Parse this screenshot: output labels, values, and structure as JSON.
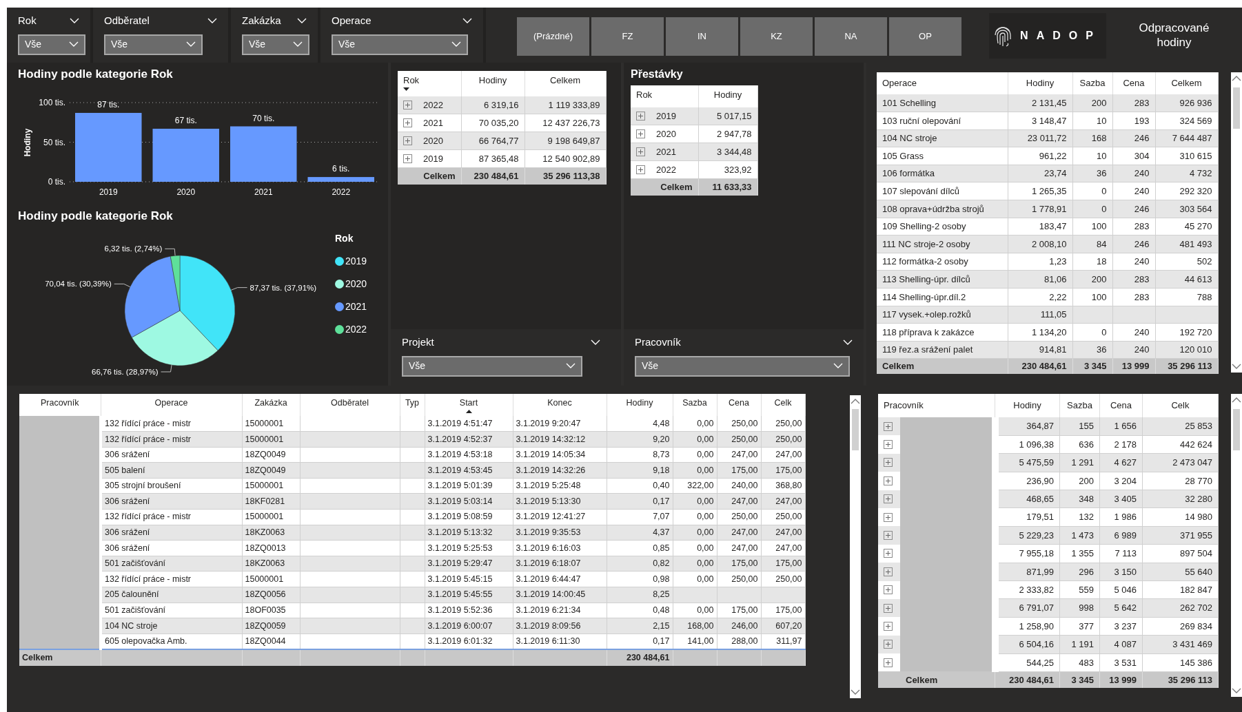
{
  "filters": [
    {
      "label": "Rok",
      "value": "Vše"
    },
    {
      "label": "Odběratel",
      "value": "Vše"
    },
    {
      "label": "Zakázka",
      "value": "Vše"
    },
    {
      "label": "Operace",
      "value": "Vše"
    }
  ],
  "type_buttons": [
    "(Prázdné)",
    "FZ",
    "IN",
    "KZ",
    "NA",
    "OP"
  ],
  "logo": {
    "text": "NADOP"
  },
  "page_title": "Odpracované hodiny",
  "bar_chart": {
    "chart_data": {
      "type": "bar",
      "title": "Hodiny podle kategorie Rok",
      "ylabel": "Hodiny",
      "categories": [
        "2019",
        "2020",
        "2021",
        "2022"
      ],
      "values": [
        87,
        67,
        70,
        6
      ],
      "ylim": [
        0,
        100
      ],
      "yticks": [
        {
          "value": 0,
          "label": "0 tis."
        },
        {
          "value": 50,
          "label": "50 tis."
        },
        {
          "value": 100,
          "label": "100 tis."
        }
      ],
      "value_labels": [
        "87 tis.",
        "67 tis.",
        "70 tis.",
        "6 tis."
      ]
    }
  },
  "pie_chart": {
    "chart_data": {
      "type": "pie",
      "title": "Hodiny podle kategorie Rok",
      "categories": [
        "2019",
        "2020",
        "2021",
        "2022"
      ],
      "values": [
        87.37,
        66.76,
        70.04,
        6.32
      ],
      "value_labels": [
        "87,37 tis. (37,91%)",
        "66,76 tis. (28,97%)",
        "70,04 tis. (30,39%)",
        "6,32 tis. (2,74%)"
      ]
    },
    "legend": {
      "title": "Rok",
      "items": [
        {
          "color": "#41e4f8"
        },
        {
          "color": "#9ef9e2"
        },
        {
          "color": "#6699ff"
        },
        {
          "color": "#5ee09a"
        }
      ]
    }
  },
  "year_table": {
    "columns": [
      {
        "label": "Rok",
        "sorted_desc": true
      },
      {
        "label": "Hodiny"
      },
      {
        "label": "Celkem"
      }
    ],
    "rows": [
      {
        "cells": [
          "2022",
          "6 319,16",
          "1 119 333,89"
        ],
        "expanded": false
      },
      {
        "cells": [
          "2021",
          "70 035,20",
          "12 437 226,73"
        ],
        "expanded": false
      },
      {
        "cells": [
          "2020",
          "66 764,77",
          "9 198 649,87"
        ],
        "expanded": false
      },
      {
        "cells": [
          "2019",
          "87 365,48",
          "12 540 902,89"
        ],
        "expanded": false
      }
    ],
    "total": [
      "Celkem",
      "230 484,61",
      "35 296 113,38"
    ]
  },
  "breaks_table": {
    "title": "Přestávky",
    "columns": [
      {
        "label": "Rok"
      },
      {
        "label": "Hodiny"
      }
    ],
    "rows": [
      {
        "cells": [
          "2019",
          "5 017,15"
        ],
        "expanded": false
      },
      {
        "cells": [
          "2020",
          "2 947,78"
        ],
        "expanded": false
      },
      {
        "cells": [
          "2021",
          "3 344,48"
        ],
        "expanded": false
      },
      {
        "cells": [
          "2022",
          "323,92"
        ],
        "expanded": false
      }
    ],
    "total": [
      "Celkem",
      "11 633,33"
    ]
  },
  "project_filter": {
    "label": "Projekt",
    "value": "Vše"
  },
  "worker_filter": {
    "label": "Pracovník",
    "value": "Vše"
  },
  "operations_table": {
    "columns": [
      "Operace",
      "Hodiny",
      "Sazba",
      "Cena",
      "Celkem"
    ],
    "rows": [
      [
        "101 Schelling",
        "2 131,45",
        "200",
        "283",
        "926 936"
      ],
      [
        "103 ruční olepování",
        "3 148,47",
        "10",
        "193",
        "324 569"
      ],
      [
        "104 NC stroje",
        "23 011,72",
        "168",
        "246",
        "7 644 487"
      ],
      [
        "105 Grass",
        "961,22",
        "10",
        "304",
        "310 615"
      ],
      [
        "106 formátka",
        "23,74",
        "36",
        "240",
        "4 732"
      ],
      [
        "107 slepování dílců",
        "1 265,35",
        "0",
        "240",
        "292 320"
      ],
      [
        "108 oprava+údržba strojů",
        "1 778,91",
        "0",
        "246",
        "303 564"
      ],
      [
        "109 Shelling-2 osoby",
        "183,47",
        "100",
        "283",
        "45 270"
      ],
      [
        "111 NC stroje-2 osoby",
        "2 008,10",
        "84",
        "246",
        "481 493"
      ],
      [
        "112 formátka-2 osoby",
        "1,23",
        "18",
        "240",
        "502"
      ],
      [
        "113 Shelling-úpr. dílců",
        "81,06",
        "200",
        "283",
        "44 613"
      ],
      [
        "114 Shelling-úpr.díl.2",
        "2,22",
        "100",
        "283",
        "788"
      ],
      [
        "117 vysek.+olep.rožků",
        "111,05"
      ],
      [
        "118 příprava k zakázce",
        "1 134,20",
        "0",
        "240",
        "192 720"
      ],
      [
        "119 řez.a srážení palet",
        "914,81",
        "36",
        "240",
        "120 010"
      ]
    ],
    "total": [
      "Celkem",
      "230 484,61",
      "3 345",
      "13 999",
      "35 296 113"
    ]
  },
  "records_table": {
    "columns": [
      {
        "label": "Pracovník"
      },
      {
        "label": "Operace"
      },
      {
        "label": "Zakázka"
      },
      {
        "label": "Odběratel"
      },
      {
        "label": "Typ"
      },
      {
        "label": "Start",
        "sorted_asc": true
      },
      {
        "label": "Konec"
      },
      {
        "label": "Hodiny"
      },
      {
        "label": "Sazba"
      },
      {
        "label": "Cena"
      },
      {
        "label": "Celk"
      }
    ],
    "rows": [
      {
        "operace": "132 řídící práce - mistr",
        "zakazka": "15000001",
        "start": "3.1.2019 4:51:47",
        "konec": "3.1.2019 9:20:47",
        "hodiny": "4,48",
        "sazba": "0,00",
        "cena": "250,00",
        "celk": "250,00"
      },
      {
        "operace": "132 řídící práce - mistr",
        "zakazka": "15000001",
        "start": "3.1.2019 4:52:37",
        "konec": "3.1.2019 14:32:12",
        "hodiny": "9,20",
        "sazba": "0,00",
        "cena": "250,00",
        "celk": "250,00"
      },
      {
        "operace": "306 srážení",
        "zakazka": "18ZQ0049",
        "start": "3.1.2019 4:53:18",
        "konec": "3.1.2019 14:05:34",
        "hodiny": "8,73",
        "sazba": "0,00",
        "cena": "247,00",
        "celk": "247,00"
      },
      {
        "operace": "505 balení",
        "zakazka": "18ZQ0049",
        "start": "3.1.2019 4:53:45",
        "konec": "3.1.2019 14:32:26",
        "hodiny": "9,18",
        "sazba": "0,00",
        "cena": "175,00",
        "celk": "175,00"
      },
      {
        "operace": "305 strojní broušení",
        "zakazka": "15000001",
        "start": "3.1.2019 5:01:39",
        "konec": "3.1.2019 5:25:48",
        "hodiny": "0,40",
        "sazba": "322,00",
        "cena": "240,00",
        "celk": "368,80"
      },
      {
        "operace": "306 srážení",
        "zakazka": "18KF0281",
        "start": "3.1.2019 5:03:14",
        "konec": "3.1.2019 5:13:30",
        "hodiny": "0,17",
        "sazba": "0,00",
        "cena": "247,00",
        "celk": "247,00"
      },
      {
        "operace": "132 řídící práce - mistr",
        "zakazka": "15000001",
        "start": "3.1.2019 5:08:59",
        "konec": "3.1.2019 12:41:27",
        "hodiny": "7,07",
        "sazba": "0,00",
        "cena": "250,00",
        "celk": "250,00"
      },
      {
        "operace": "306 srážení",
        "zakazka": "18KZ0063",
        "start": "3.1.2019 5:13:32",
        "konec": "3.1.2019 9:35:53",
        "hodiny": "4,37",
        "sazba": "0,00",
        "cena": "247,00",
        "celk": "247,00"
      },
      {
        "operace": "306 srážení",
        "zakazka": "18ZQ0013",
        "start": "3.1.2019 5:25:53",
        "konec": "3.1.2019 6:16:03",
        "hodiny": "0,85",
        "sazba": "0,00",
        "cena": "247,00",
        "celk": "247,00"
      },
      {
        "operace": "501 začišťování",
        "zakazka": "18KZ0063",
        "start": "3.1.2019 5:29:47",
        "konec": "3.1.2019 6:18:07",
        "hodiny": "0,82",
        "sazba": "0,00",
        "cena": "175,00",
        "celk": "175,00"
      },
      {
        "operace": "132 řídící práce - mistr",
        "zakazka": "15000001",
        "start": "3.1.2019 5:45:15",
        "konec": "3.1.2019 6:44:47",
        "hodiny": "0,98",
        "sazba": "0,00",
        "cena": "250,00",
        "celk": "250,00"
      },
      {
        "operace": "205 čalounění",
        "zakazka": "18ZQ0056",
        "start": "3.1.2019 5:45:55",
        "konec": "3.1.2019 14:00:45",
        "hodiny": "8,25"
      },
      {
        "operace": "501 začišťování",
        "zakazka": "18OF0035",
        "start": "3.1.2019 5:52:36",
        "konec": "3.1.2019 6:21:34",
        "hodiny": "0,48",
        "sazba": "0,00",
        "cena": "175,00",
        "celk": "175,00"
      },
      {
        "operace": "104 NC stroje",
        "zakazka": "18ZQ0059",
        "start": "3.1.2019 6:00:07",
        "konec": "3.1.2019 8:09:56",
        "hodiny": "2,15",
        "sazba": "168,00",
        "cena": "246,00",
        "celk": "607,20"
      },
      {
        "operace": "605 olepovačka Amb.",
        "zakazka": "18ZQ0044",
        "start": "3.1.2019 6:01:32",
        "konec": "3.1.2019 6:11:30",
        "hodiny": "0,17",
        "sazba": "141,00",
        "cena": "288,00",
        "celk": "311,97"
      }
    ],
    "total": {
      "label": "Celkem",
      "hodiny": "230 484,61"
    }
  },
  "workers_table": {
    "columns": [
      "Pracovník",
      "Hodiny",
      "Sazba",
      "Cena",
      "Celk"
    ],
    "rows": [
      {
        "cells": [
          "",
          "364,87",
          "155",
          "1 656",
          "25 853"
        ],
        "expanded": false
      },
      {
        "cells": [
          "",
          "1 096,38",
          "636",
          "2 178",
          "442 624"
        ],
        "expanded": false
      },
      {
        "cells": [
          "",
          "5 475,59",
          "1 291",
          "4 627",
          "2 473 047"
        ],
        "expanded": false
      },
      {
        "cells": [
          "",
          "236,90",
          "200",
          "3 204",
          "28 770"
        ],
        "expanded": false
      },
      {
        "cells": [
          "",
          "468,65",
          "348",
          "3 405",
          "32 280"
        ],
        "expanded": false
      },
      {
        "cells": [
          "",
          "179,51",
          "132",
          "1 986",
          "14 980"
        ],
        "expanded": false
      },
      {
        "cells": [
          "",
          "5 229,23",
          "1 473",
          "6 989",
          "371 955"
        ],
        "expanded": false
      },
      {
        "cells": [
          "",
          "7 955,18",
          "1 355",
          "7 113",
          "897 504"
        ],
        "expanded": false
      },
      {
        "cells": [
          "",
          "871,99",
          "296",
          "3 150",
          "55 640"
        ],
        "expanded": false
      },
      {
        "cells": [
          "",
          "2 333,82",
          "559",
          "5 046",
          "182 847"
        ],
        "expanded": false
      },
      {
        "cells": [
          "",
          "6 791,07",
          "998",
          "5 642",
          "262 702"
        ],
        "expanded": false
      },
      {
        "cells": [
          "",
          "1 258,90",
          "377",
          "3 237",
          "269 834"
        ],
        "expanded": false
      },
      {
        "cells": [
          "",
          "6 504,16",
          "1 191",
          "4 087",
          "3 431 469"
        ],
        "expanded": false
      },
      {
        "cells": [
          "",
          "544,25",
          "483",
          "3 531",
          "145 386"
        ],
        "expanded": false
      }
    ],
    "total": [
      "Celkem",
      "230 484,61",
      "3 345",
      "13 999",
      "35 296 113"
    ]
  }
}
